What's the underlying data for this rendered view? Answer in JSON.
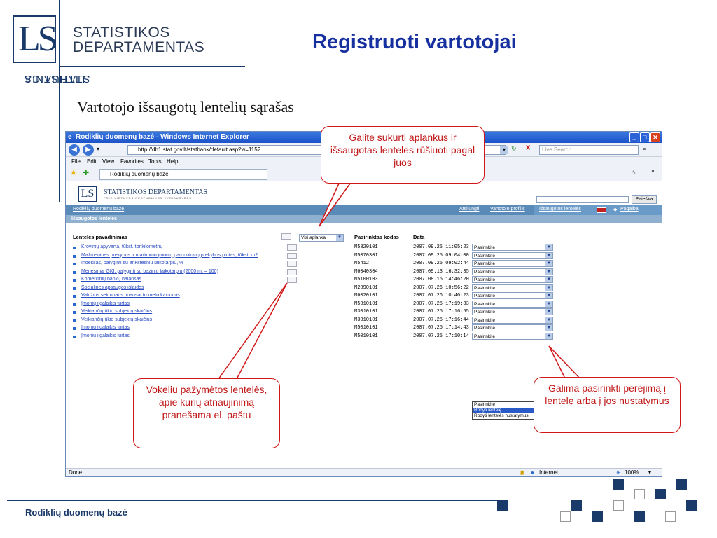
{
  "slide": {
    "brand_line1": "STATISTIKOS",
    "brand_line2": "DEPARTAMENTAS",
    "side_line1": "STATISTICS",
    "side_line2": "LITHUANIA",
    "logo": "LS",
    "title": "Registruoti vartotojai",
    "subtitle": "Vartotojo išsaugotų lentelių sąrašas",
    "footer": "Rodiklių duomenų bazė",
    "accent": "#1a3a6a",
    "title_color": "#1630a0",
    "callout_color": "#c01818"
  },
  "browser": {
    "title": "Rodiklių duomenų bazė - Windows Internet Explorer",
    "url": "http://db1.stat.gov.lt/statbank/default.asp?w=1152",
    "search_placeholder": "Live Search",
    "menu": [
      "File",
      "Edit",
      "View",
      "Favorites",
      "Tools",
      "Help"
    ],
    "tab_title": "Rodiklių duomenų bazė",
    "status_left": "Done",
    "status_zone": "Internet",
    "zoom": "100%"
  },
  "site": {
    "logo": "LS",
    "name": "STATISTIKOS DEPARTAMENTAS",
    "sub": "PRIE LIETUVOS RESPUBLIKOS VYRIAUSYBĖS",
    "search_button": "Paieška",
    "breadcrumb": "Rodiklių duomenų bazė",
    "nav": {
      "logout": "Atsijungti",
      "profile": "Vartotojo profilis",
      "saved": "Išsaugotos lentelės",
      "help": "Pagalba"
    },
    "section": "Išsaugotos lentelės"
  },
  "table": {
    "headers": {
      "name": "Lentelės pavadinimas",
      "folder": "Visi aplankai",
      "code": "Pasirinktas kodas",
      "date": "Data"
    },
    "select_default": "Pasirinkite",
    "rows": [
      {
        "name": "Krovinių apyvarta, tūkst. tonkilometrių",
        "code": "M5820101",
        "date": "2007.09.25 11:05:23",
        "mail": true
      },
      {
        "name": "Mažmeninės prekybos ir maitinimo įmonių parduotuvių prekybos plotas, tūkst. m2",
        "code": "M5070301",
        "date": "2007.09.25 09:04:00",
        "mail": true
      },
      {
        "name": "Indeksas, palyginti su ankstesniu laikotarpiu, %",
        "code": "M5412",
        "date": "2007.09.25 09:02:44",
        "mail": true
      },
      {
        "name": "Mėnesiniai GKI, palyginti su baziniu laikotarpiu (2000 m. = 100)",
        "code": "M6040304",
        "date": "2007.09.13 16:32:35",
        "mail": true
      },
      {
        "name": "Komercinių bankų balansas",
        "code": "M5100103",
        "date": "2007.08.15 14:46:20",
        "mail": true
      },
      {
        "name": "Socialinės apsaugos išlaidos",
        "code": "M2090101",
        "date": "2007.07.26 10:56:22",
        "mail": false
      },
      {
        "name": "Valdžios sektoriaus finansai to meto kainomis",
        "code": "M6020101",
        "date": "2007.07.26 10:40:23",
        "mail": false
      },
      {
        "name": "Įmonių ilgalaikis turtas",
        "code": "M5010101",
        "date": "2007.07.25 17:19:33",
        "mail": false
      },
      {
        "name": "Veikiančių ūkio subjektų skaičius",
        "code": "M3010101",
        "date": "2007.07.25 17:16:55",
        "mail": false
      },
      {
        "name": "Veikiančių ūkio subjektų skaičius",
        "code": "M3010101",
        "date": "2007.07.25 17:16:44",
        "mail": false
      },
      {
        "name": "Įmonių ilgalaikis turtas",
        "code": "M5010101",
        "date": "2007.07.25 17:14:43",
        "mail": false
      },
      {
        "name": "Įmonių ilgalaikis turtas",
        "code": "M5010101",
        "date": "2007.07.25 17:10:14",
        "mail": false
      }
    ],
    "dropdown_options": [
      "Pasirinkite",
      "Rodyti lentelę",
      "Rodyti lentelės nustatymus"
    ],
    "dropdown_highlighted": 1
  },
  "callouts": {
    "folders": "Galite sukurti aplankus ir išsaugotas lenteles rūšiuoti pagal juos",
    "envelope": "Vokeliu pažymėtos lentelės, apie kurių atnaujinimą pranešama el. paštu",
    "actions": "Galima pasirinkti perėjimą į lentelę arba į jos nustatymus"
  }
}
